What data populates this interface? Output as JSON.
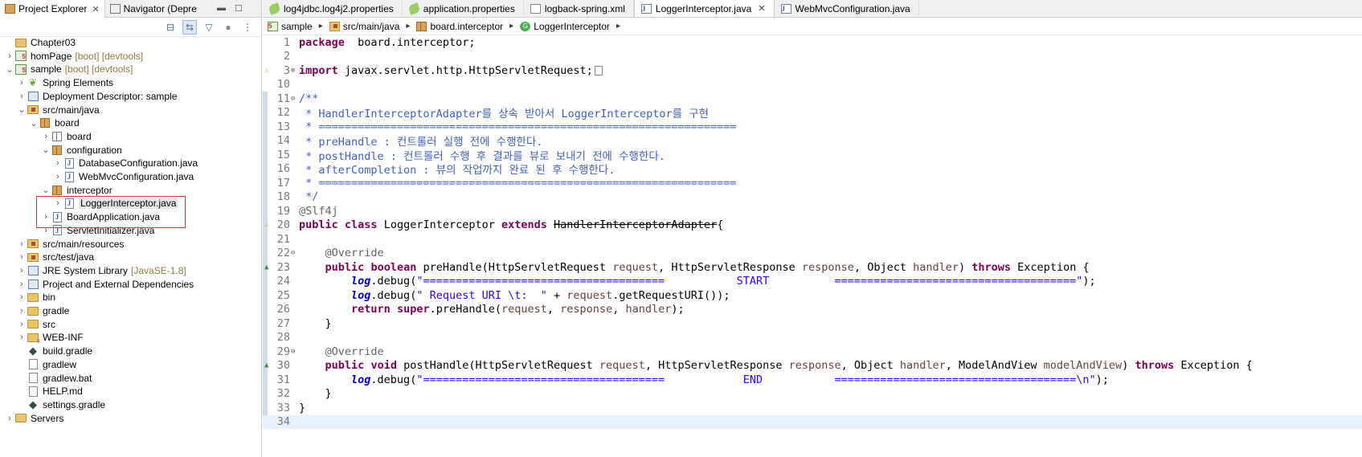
{
  "left_panel": {
    "tabs": [
      {
        "label": "Project Explorer",
        "close": "✕"
      },
      {
        "label": "Navigator (Depre",
        "close": ""
      }
    ],
    "tree": [
      {
        "label": "Chapter03",
        "deco": "",
        "indent": 0,
        "arrow": "",
        "icon": "project"
      },
      {
        "label": "homPage",
        "deco": "[boot] [devtools]",
        "indent": 0,
        "arrow": ">",
        "icon": "boot"
      },
      {
        "label": "sample",
        "deco": "[boot] [devtools]",
        "indent": 0,
        "arrow": "v",
        "icon": "boot"
      },
      {
        "label": "Spring Elements",
        "deco": "",
        "indent": 1,
        "arrow": ">",
        "icon": "leaf"
      },
      {
        "label": "Deployment Descriptor: sample",
        "deco": "",
        "indent": 1,
        "arrow": ">",
        "icon": "lib"
      },
      {
        "label": "src/main/java",
        "deco": "",
        "indent": 1,
        "arrow": "v",
        "icon": "srcfolder"
      },
      {
        "label": "board",
        "deco": "",
        "indent": 2,
        "arrow": "v",
        "icon": "pkg"
      },
      {
        "label": "board",
        "deco": "",
        "indent": 3,
        "arrow": ">",
        "icon": "pkg-empty"
      },
      {
        "label": "configuration",
        "deco": "",
        "indent": 3,
        "arrow": "v",
        "icon": "pkg"
      },
      {
        "label": "DatabaseConfiguration.java",
        "deco": "",
        "indent": 4,
        "arrow": ">",
        "icon": "java"
      },
      {
        "label": "WebMvcConfiguration.java",
        "deco": "",
        "indent": 4,
        "arrow": ">",
        "icon": "java"
      },
      {
        "label": "interceptor",
        "deco": "",
        "indent": 3,
        "arrow": "v",
        "icon": "pkg"
      },
      {
        "label": "LoggerInterceptor.java",
        "deco": "",
        "indent": 4,
        "arrow": ">",
        "icon": "java",
        "selected": true
      },
      {
        "label": "BoardApplication.java",
        "deco": "",
        "indent": 3,
        "arrow": ">",
        "icon": "java"
      },
      {
        "label": "ServletInitializer.java",
        "deco": "",
        "indent": 3,
        "arrow": ">",
        "icon": "java"
      },
      {
        "label": "src/main/resources",
        "deco": "",
        "indent": 1,
        "arrow": ">",
        "icon": "srcfolder"
      },
      {
        "label": "src/test/java",
        "deco": "",
        "indent": 1,
        "arrow": ">",
        "icon": "srcfolder"
      },
      {
        "label": "JRE System Library",
        "deco": "[JavaSE-1.8]",
        "indent": 1,
        "arrow": ">",
        "icon": "lib"
      },
      {
        "label": "Project and External Dependencies",
        "deco": "",
        "indent": 1,
        "arrow": ">",
        "icon": "lib"
      },
      {
        "label": "bin",
        "deco": "",
        "indent": 1,
        "arrow": ">",
        "icon": "folder"
      },
      {
        "label": "gradle",
        "deco": "",
        "indent": 1,
        "arrow": ">",
        "icon": "folder"
      },
      {
        "label": "src",
        "deco": "",
        "indent": 1,
        "arrow": ">",
        "icon": "folder"
      },
      {
        "label": "WEB-INF",
        "deco": "",
        "indent": 1,
        "arrow": ">",
        "icon": "web"
      },
      {
        "label": "build.gradle",
        "deco": "",
        "indent": 1,
        "arrow": "",
        "icon": "gradle"
      },
      {
        "label": "gradlew",
        "deco": "",
        "indent": 1,
        "arrow": "",
        "icon": "file"
      },
      {
        "label": "gradlew.bat",
        "deco": "",
        "indent": 1,
        "arrow": "",
        "icon": "file"
      },
      {
        "label": "HELP.md",
        "deco": "",
        "indent": 1,
        "arrow": "",
        "icon": "file"
      },
      {
        "label": "settings.gradle",
        "deco": "",
        "indent": 1,
        "arrow": "",
        "icon": "gradle"
      },
      {
        "label": "Servers",
        "deco": "",
        "indent": 0,
        "arrow": ">",
        "icon": "folder"
      }
    ]
  },
  "editor": {
    "tabs": [
      {
        "label": "log4jdbc.log4j2.properties",
        "icon": "props",
        "active": false
      },
      {
        "label": "application.properties",
        "icon": "props",
        "active": false
      },
      {
        "label": "logback-spring.xml",
        "icon": "xml",
        "active": false
      },
      {
        "label": "LoggerInterceptor.java",
        "icon": "java",
        "active": true,
        "close": "✕"
      },
      {
        "label": "WebMvcConfiguration.java",
        "icon": "java",
        "active": false
      }
    ],
    "breadcrumb": [
      "sample",
      "src/main/java",
      "board.interceptor",
      "LoggerInterceptor"
    ],
    "lines": [
      {
        "n": "1",
        "segs": [
          [
            "kw",
            "package"
          ],
          [
            "",
            "  board.interceptor;"
          ]
        ]
      },
      {
        "n": "2",
        "segs": []
      },
      {
        "n": "3",
        "fold": "⊕",
        "mark": "warn",
        "segs": [
          [
            "kw",
            "import"
          ],
          [
            "",
            " javax.servlet.http.HttpServletRequest;"
          ],
          [
            "box",
            "□"
          ]
        ]
      },
      {
        "n": "10",
        "segs": []
      },
      {
        "n": "11",
        "fold": "⊖",
        "segs": [
          [
            "doc",
            "/**"
          ]
        ]
      },
      {
        "n": "12",
        "segs": [
          [
            "doc",
            " * HandlerInterceptorAdapter를 상속 받아서 LoggerInterceptor를 구현"
          ]
        ]
      },
      {
        "n": "13",
        "segs": [
          [
            "doc",
            " * ================================================================"
          ]
        ]
      },
      {
        "n": "14",
        "segs": [
          [
            "doc",
            " * preHandle : 컨트롤러 실행 전에 수행한다."
          ]
        ]
      },
      {
        "n": "15",
        "segs": [
          [
            "doc",
            " * postHandle : 컨트롤러 수행 후 결과를 뷰로 보내기 전에 수행한다."
          ]
        ]
      },
      {
        "n": "16",
        "segs": [
          [
            "doc",
            " * afterCompletion : 뷰의 작업까지 완료 된 후 수행한다."
          ]
        ]
      },
      {
        "n": "17",
        "segs": [
          [
            "doc",
            " * ================================================================"
          ]
        ]
      },
      {
        "n": "18",
        "segs": [
          [
            "doc",
            " */"
          ]
        ]
      },
      {
        "n": "19",
        "segs": [
          [
            "ann",
            "@Slf4j"
          ]
        ]
      },
      {
        "n": "20",
        "mark": "warn",
        "segs": [
          [
            "kw",
            "public"
          ],
          [
            "",
            " "
          ],
          [
            "kw",
            "class"
          ],
          [
            "",
            " LoggerInterceptor "
          ],
          [
            "kw",
            "extends"
          ],
          [
            "",
            " "
          ],
          [
            "strike",
            "HandlerInterceptorAdapter"
          ],
          [
            "",
            "{"
          ]
        ]
      },
      {
        "n": "21",
        "segs": []
      },
      {
        "n": "22",
        "fold": "⊖",
        "segs": [
          [
            "",
            "    "
          ],
          [
            "ann",
            "@Override"
          ]
        ]
      },
      {
        "n": "23",
        "mark": "ovr",
        "segs": [
          [
            "",
            "    "
          ],
          [
            "kw",
            "public"
          ],
          [
            "",
            " "
          ],
          [
            "kw",
            "boolean"
          ],
          [
            "",
            " preHandle(HttpServletRequest "
          ],
          [
            "par",
            "request"
          ],
          [
            "",
            ", HttpServletResponse "
          ],
          [
            "par",
            "response"
          ],
          [
            "",
            ", Object "
          ],
          [
            "par",
            "handler"
          ],
          [
            "",
            ") "
          ],
          [
            "kw",
            "throws"
          ],
          [
            "",
            " Exception {"
          ]
        ]
      },
      {
        "n": "24",
        "segs": [
          [
            "",
            "        "
          ],
          [
            "fld",
            "log"
          ],
          [
            "",
            ".debug("
          ],
          [
            "str",
            "\"=====================================           START          =====================================\""
          ],
          [
            "",
            ");"
          ]
        ]
      },
      {
        "n": "25",
        "segs": [
          [
            "",
            "        "
          ],
          [
            "fld",
            "log"
          ],
          [
            "",
            ".debug("
          ],
          [
            "str",
            "\" Request URI \\t:  \""
          ],
          [
            "",
            " + "
          ],
          [
            "par",
            "request"
          ],
          [
            "",
            ".getRequestURI());"
          ]
        ]
      },
      {
        "n": "26",
        "segs": [
          [
            "",
            "        "
          ],
          [
            "kw",
            "return"
          ],
          [
            "",
            " "
          ],
          [
            "kw",
            "super"
          ],
          [
            "",
            ".preHandle("
          ],
          [
            "par",
            "request"
          ],
          [
            "",
            ", "
          ],
          [
            "par",
            "response"
          ],
          [
            "",
            ", "
          ],
          [
            "par",
            "handler"
          ],
          [
            "",
            ");"
          ]
        ]
      },
      {
        "n": "27",
        "segs": [
          [
            "",
            "    }"
          ]
        ]
      },
      {
        "n": "28",
        "segs": []
      },
      {
        "n": "29",
        "fold": "⊖",
        "segs": [
          [
            "",
            "    "
          ],
          [
            "ann",
            "@Override"
          ]
        ]
      },
      {
        "n": "30",
        "mark": "ovr",
        "segs": [
          [
            "",
            "    "
          ],
          [
            "kw",
            "public"
          ],
          [
            "",
            " "
          ],
          [
            "kw",
            "void"
          ],
          [
            "",
            " postHandle(HttpServletRequest "
          ],
          [
            "par",
            "request"
          ],
          [
            "",
            ", HttpServletResponse "
          ],
          [
            "par",
            "response"
          ],
          [
            "",
            ", Object "
          ],
          [
            "par",
            "handler"
          ],
          [
            "",
            ", ModelAndView "
          ],
          [
            "par",
            "modelAndView"
          ],
          [
            "",
            ") "
          ],
          [
            "kw",
            "throws"
          ],
          [
            "",
            " Exception {"
          ]
        ]
      },
      {
        "n": "31",
        "segs": [
          [
            "",
            "        "
          ],
          [
            "fld",
            "log"
          ],
          [
            "",
            ".debug("
          ],
          [
            "str",
            "\"=====================================            END           =====================================\\n\""
          ],
          [
            "",
            ");"
          ]
        ]
      },
      {
        "n": "32",
        "segs": [
          [
            "",
            "    }"
          ]
        ]
      },
      {
        "n": "33",
        "segs": [
          [
            "",
            "}"
          ]
        ]
      },
      {
        "n": "34",
        "segs": []
      }
    ]
  },
  "colors": {
    "keyword": "#7f0055",
    "javadoc": "#3f5fbf",
    "string": "#2a00ff",
    "annotation": "#646464",
    "highlight": "#e03131"
  }
}
